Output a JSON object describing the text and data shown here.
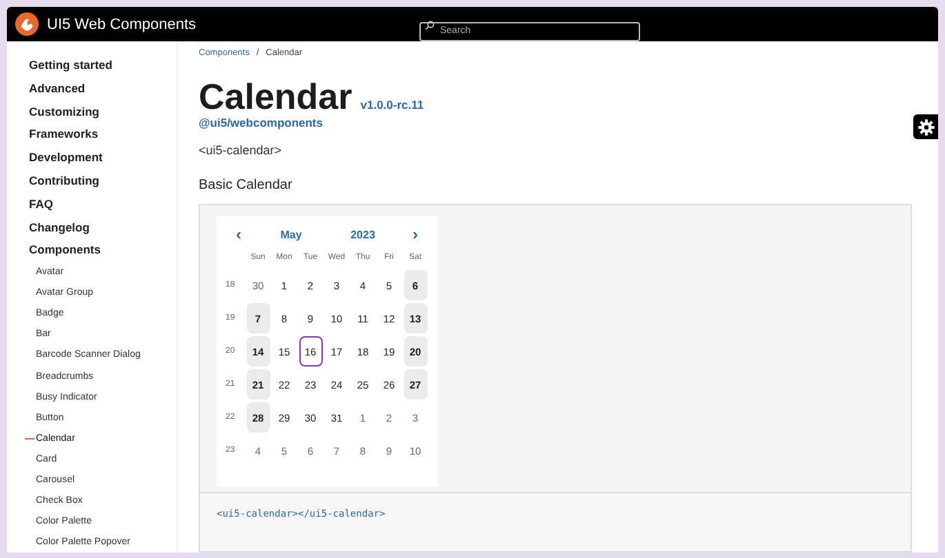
{
  "header": {
    "title": "UI5 Web Components",
    "search": {
      "placeholder": "Search"
    }
  },
  "sidebar": {
    "items": [
      {
        "label": "Getting started"
      },
      {
        "label": "Advanced"
      },
      {
        "label": "Customizing"
      },
      {
        "label": "Frameworks"
      },
      {
        "label": "Development"
      },
      {
        "label": "Contributing"
      },
      {
        "label": "FAQ"
      },
      {
        "label": "Changelog"
      },
      {
        "label": "Components",
        "children": [
          {
            "label": "Avatar",
            "selected": false
          },
          {
            "label": "Avatar Group",
            "selected": false
          },
          {
            "label": "Badge",
            "selected": false
          },
          {
            "label": "Bar",
            "selected": false
          },
          {
            "label": "Barcode Scanner Dialog",
            "selected": false
          },
          {
            "label": "Breadcrumbs",
            "selected": false
          },
          {
            "label": "Busy Indicator",
            "selected": false
          },
          {
            "label": "Button",
            "selected": false
          },
          {
            "label": "Calendar",
            "selected": true
          },
          {
            "label": "Card",
            "selected": false
          },
          {
            "label": "Carousel",
            "selected": false
          },
          {
            "label": "Check Box",
            "selected": false
          },
          {
            "label": "Color Palette",
            "selected": false
          },
          {
            "label": "Color Palette Popover",
            "selected": false
          }
        ]
      }
    ]
  },
  "breadcrumbs": [
    {
      "label": "Components",
      "kind": "link"
    },
    {
      "label": "/",
      "kind": "separator"
    },
    {
      "label": "Calendar",
      "kind": "current"
    }
  ],
  "page": {
    "title": "Calendar",
    "version": "v1.0.0-rc.11",
    "package": "@ui5/webcomponents",
    "tag": "<ui5-calendar>",
    "section": "Basic Calendar"
  },
  "calendar": {
    "prev": "‹",
    "month": "May",
    "year": "2023",
    "next": "›",
    "weekdays": [
      "Sun",
      "Mon",
      "Tue",
      "Wed",
      "Thu",
      "Fri",
      "Sat"
    ],
    "weeks": [
      {
        "number": "18",
        "days": [
          {
            "label": "30",
            "other": true,
            "weekend": false,
            "today": false
          },
          {
            "label": "1",
            "other": false,
            "weekend": false,
            "today": false
          },
          {
            "label": "2",
            "other": false,
            "weekend": false,
            "today": false
          },
          {
            "label": "3",
            "other": false,
            "weekend": false,
            "today": false
          },
          {
            "label": "4",
            "other": false,
            "weekend": false,
            "today": false
          },
          {
            "label": "5",
            "other": false,
            "weekend": false,
            "today": false
          },
          {
            "label": "6",
            "other": false,
            "weekend": true,
            "today": false
          }
        ]
      },
      {
        "number": "19",
        "days": [
          {
            "label": "7",
            "other": false,
            "weekend": true,
            "today": false
          },
          {
            "label": "8",
            "other": false,
            "weekend": false,
            "today": false
          },
          {
            "label": "9",
            "other": false,
            "weekend": false,
            "today": false
          },
          {
            "label": "10",
            "other": false,
            "weekend": false,
            "today": false
          },
          {
            "label": "11",
            "other": false,
            "weekend": false,
            "today": false
          },
          {
            "label": "12",
            "other": false,
            "weekend": false,
            "today": false
          },
          {
            "label": "13",
            "other": false,
            "weekend": true,
            "today": false
          }
        ]
      },
      {
        "number": "20",
        "days": [
          {
            "label": "14",
            "other": false,
            "weekend": true,
            "today": false
          },
          {
            "label": "15",
            "other": false,
            "weekend": false,
            "today": false
          },
          {
            "label": "16",
            "other": false,
            "weekend": false,
            "today": true
          },
          {
            "label": "17",
            "other": false,
            "weekend": false,
            "today": false
          },
          {
            "label": "18",
            "other": false,
            "weekend": false,
            "today": false
          },
          {
            "label": "19",
            "other": false,
            "weekend": false,
            "today": false
          },
          {
            "label": "20",
            "other": false,
            "weekend": true,
            "today": false
          }
        ]
      },
      {
        "number": "21",
        "days": [
          {
            "label": "21",
            "other": false,
            "weekend": true,
            "today": false
          },
          {
            "label": "22",
            "other": false,
            "weekend": false,
            "today": false
          },
          {
            "label": "23",
            "other": false,
            "weekend": false,
            "today": false
          },
          {
            "label": "24",
            "other": false,
            "weekend": false,
            "today": false
          },
          {
            "label": "25",
            "other": false,
            "weekend": false,
            "today": false
          },
          {
            "label": "26",
            "other": false,
            "weekend": false,
            "today": false
          },
          {
            "label": "27",
            "other": false,
            "weekend": true,
            "today": false
          }
        ]
      },
      {
        "number": "22",
        "days": [
          {
            "label": "28",
            "other": false,
            "weekend": true,
            "today": false
          },
          {
            "label": "29",
            "other": false,
            "weekend": false,
            "today": false
          },
          {
            "label": "30",
            "other": false,
            "weekend": false,
            "today": false
          },
          {
            "label": "31",
            "other": false,
            "weekend": false,
            "today": false
          },
          {
            "label": "1",
            "other": true,
            "weekend": false,
            "today": false
          },
          {
            "label": "2",
            "other": true,
            "weekend": false,
            "today": false
          },
          {
            "label": "3",
            "other": true,
            "weekend": false,
            "today": false
          }
        ]
      },
      {
        "number": "23",
        "days": [
          {
            "label": "4",
            "other": true,
            "weekend": false,
            "today": false
          },
          {
            "label": "5",
            "other": true,
            "weekend": false,
            "today": false
          },
          {
            "label": "6",
            "other": true,
            "weekend": false,
            "today": false
          },
          {
            "label": "7",
            "other": true,
            "weekend": false,
            "today": false
          },
          {
            "label": "8",
            "other": true,
            "weekend": false,
            "today": false
          },
          {
            "label": "9",
            "other": true,
            "weekend": false,
            "today": false
          },
          {
            "label": "10",
            "other": true,
            "weekend": false,
            "today": false
          }
        ]
      }
    ]
  },
  "code": "<ui5-calendar></ui5-calendar>"
}
